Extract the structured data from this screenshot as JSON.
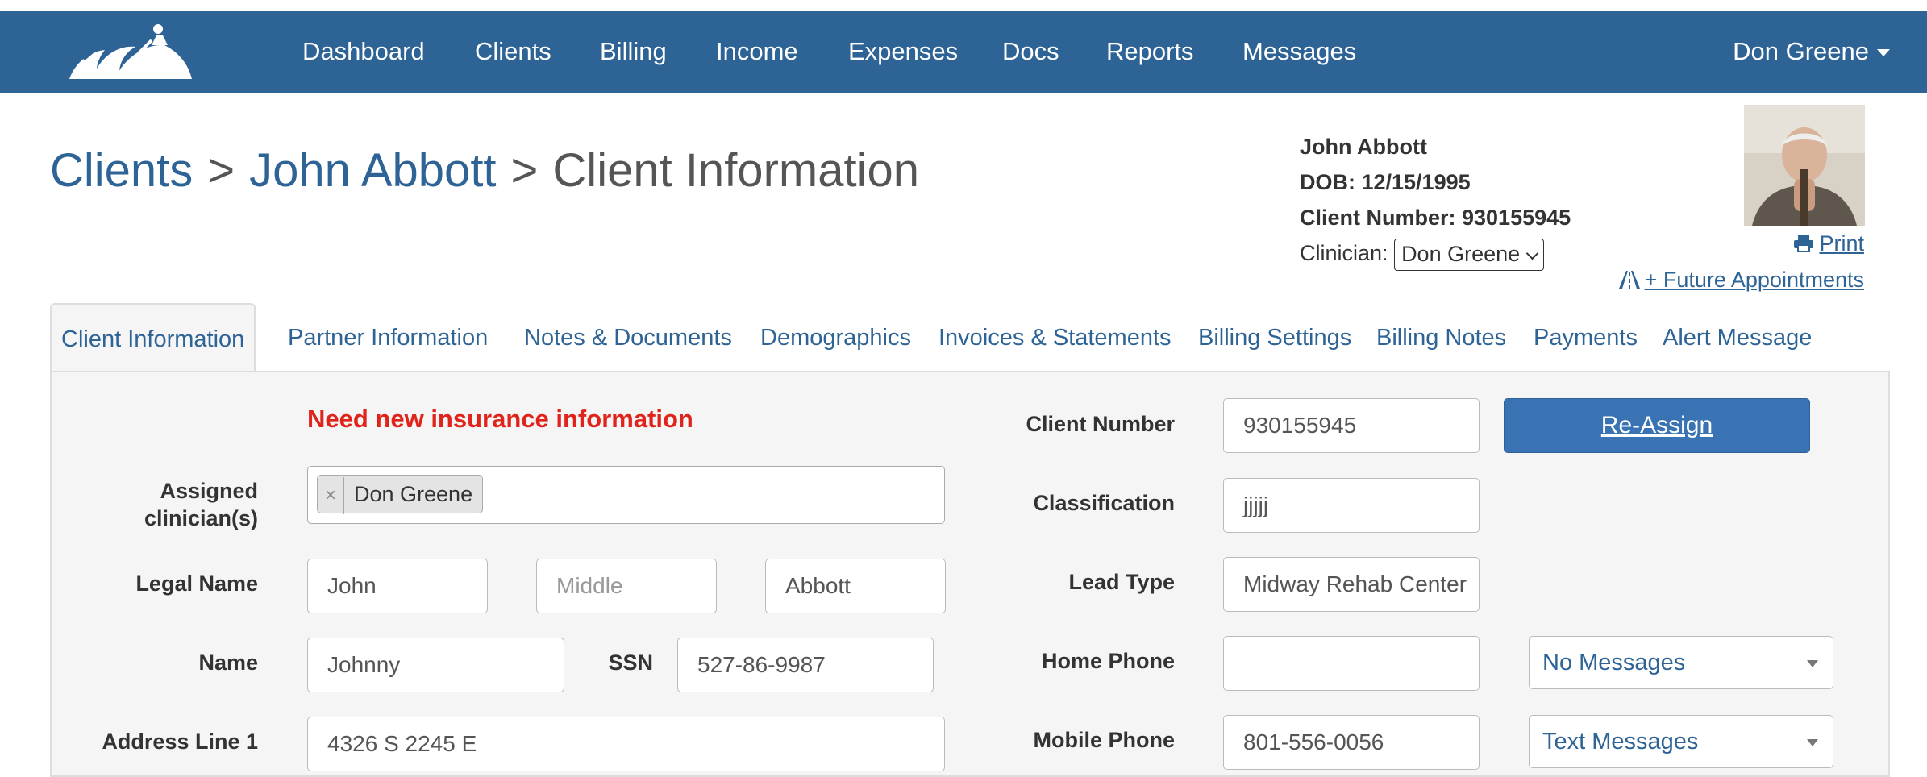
{
  "nav": {
    "items": [
      "Dashboard",
      "Clients",
      "Billing",
      "Income",
      "Expenses",
      "Docs",
      "Reports",
      "Messages"
    ],
    "user": "Don Greene"
  },
  "breadcrumb": {
    "clients": "Clients",
    "separator": ">",
    "client": "John Abbott",
    "page": "Client Information"
  },
  "client_card": {
    "name": "John Abbott",
    "dob": "DOB: 12/15/1995",
    "number": "Client Number: 930155945",
    "clinician_label": "Clinician:",
    "clinician_value": "Don Greene",
    "print": "Print",
    "future_appointments": "+ Future Appointments"
  },
  "tabs": [
    "Client Information",
    "Partner Information",
    "Notes & Documents",
    "Demographics",
    "Invoices & Statements",
    "Billing Settings",
    "Billing Notes",
    "Payments",
    "Alert Message"
  ],
  "form": {
    "alert": "Need new insurance information",
    "assigned_label_1": "Assigned",
    "assigned_label_2": "clinician(s)",
    "assigned_tag": "Don Greene",
    "assigned_tag_remove": "×",
    "legal_name_label": "Legal Name",
    "first_name": "John",
    "middle_placeholder": "Middle",
    "last_name": "Abbott",
    "name_label": "Name",
    "nickname": "Johnny",
    "ssn_label": "SSN",
    "ssn": "527-86-9987",
    "address1_label": "Address Line 1",
    "address1": "4326 S 2245 E",
    "client_number_label": "Client Number",
    "client_number": "930155945",
    "reassign": "Re-Assign",
    "classification_label": "Classification",
    "classification": "jjjjj",
    "lead_type_label": "Lead Type",
    "lead_type": "Midway Rehab Center",
    "home_phone_label": "Home Phone",
    "home_phone": "",
    "home_phone_msg": "No Messages",
    "mobile_phone_label": "Mobile Phone",
    "mobile_phone": "801-556-0056",
    "mobile_phone_msg": "Text Messages"
  }
}
